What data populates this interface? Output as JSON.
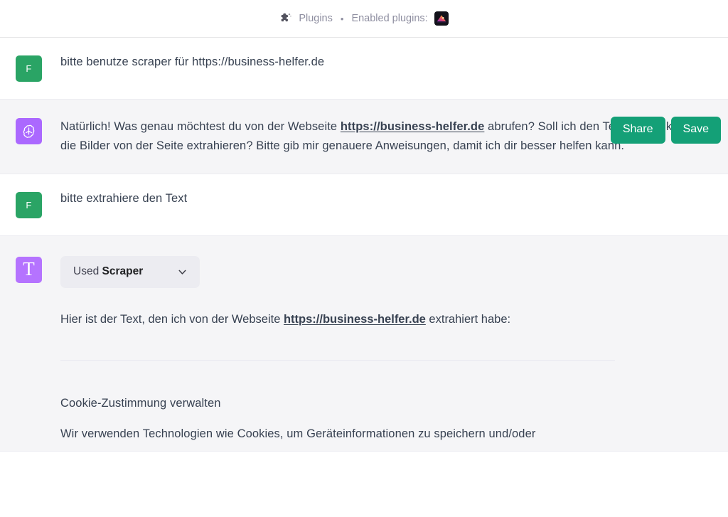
{
  "header": {
    "puzzle_icon": "puzzle-icon",
    "plugins_label": "Plugins",
    "separator": "•",
    "enabled_label": "Enabled plugins:",
    "enabled_plugin_badge_icon": "scraper-plugin-icon"
  },
  "messages": [
    {
      "role": "user",
      "avatar_letter": "F",
      "avatar_color": "#2aa465",
      "text": "bitte benutze scraper für https://business-helfer.de"
    },
    {
      "role": "assistant",
      "avatar_icon": "openai-logo-icon",
      "avatar_color": "#ab68ff",
      "text_before_link": "Natürlich! Was genau möchtest du von der Webseite ",
      "link_text": "https://business-helfer.de",
      "text_after_link": " abrufen? Soll ich den Text, die Links oder die Bilder von der Seite extrahieren? Bitte gib mir genauere Anweisungen, damit ich dir besser helfen kann.",
      "actions": {
        "share_label": "Share",
        "save_label": "Save",
        "button_color": "#14a077"
      }
    },
    {
      "role": "user",
      "avatar_letter": "F",
      "avatar_color": "#2aa465",
      "text": "bitte extrahiere den Text"
    },
    {
      "role": "plugin",
      "avatar_letter": "T",
      "avatar_color": "#b573ff",
      "tool_pill": {
        "prefix": "Used ",
        "name": "Scraper",
        "chevron_icon": "chevron-down-icon"
      },
      "intro_before_link": "Hier ist der Text, den ich von der Webseite ",
      "intro_link": "https://business-helfer.de",
      "intro_after_link": " extrahiert habe:",
      "output_lines": [
        "Cookie-Zustimmung verwalten",
        "Wir verwenden Technologien wie Cookies, um Geräteinformationen zu speichern und/oder"
      ]
    }
  ]
}
